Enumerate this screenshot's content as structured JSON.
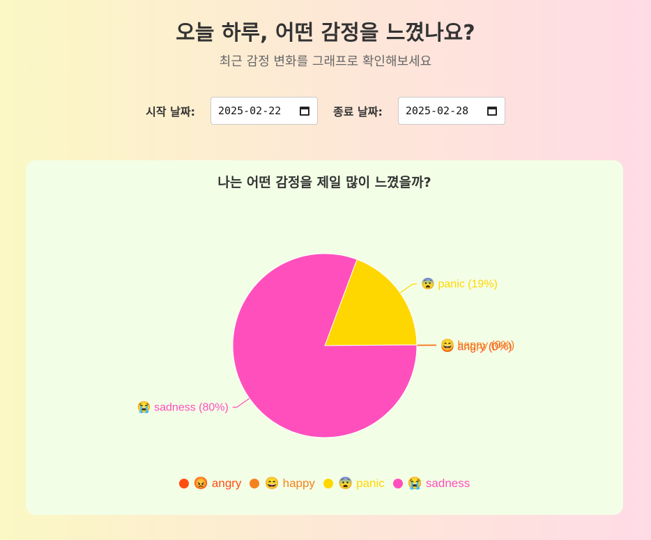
{
  "header": {
    "title": "오늘 하루, 어떤 감정을 느꼈나요?",
    "subtitle": "최근 감정 변화를 그래프로 확인해보세요"
  },
  "filters": {
    "start_label": "시작 날짜:",
    "start_value": "2025-02-22",
    "end_label": "종료 날짜:",
    "end_value": "2025-02-28"
  },
  "chart_data": {
    "type": "pie",
    "title": "나는 어떤 감정을 제일 많이 느꼈을까?",
    "slices": [
      {
        "name": "angry",
        "emoji": "😡",
        "percent": 0,
        "color": "#ff4d12",
        "label": "angry (0%)"
      },
      {
        "name": "happy",
        "emoji": "😄",
        "percent": 0,
        "color": "#f5821f",
        "label": "happy (0%)"
      },
      {
        "name": "panic",
        "emoji": "😨",
        "percent": 19,
        "color": "#ffd700",
        "label": "panic (19%)"
      },
      {
        "name": "sadness",
        "emoji": "😭",
        "percent": 80,
        "color": "#ff4fbd",
        "label": "sadness (80%)"
      }
    ],
    "legend_position": "bottom"
  }
}
